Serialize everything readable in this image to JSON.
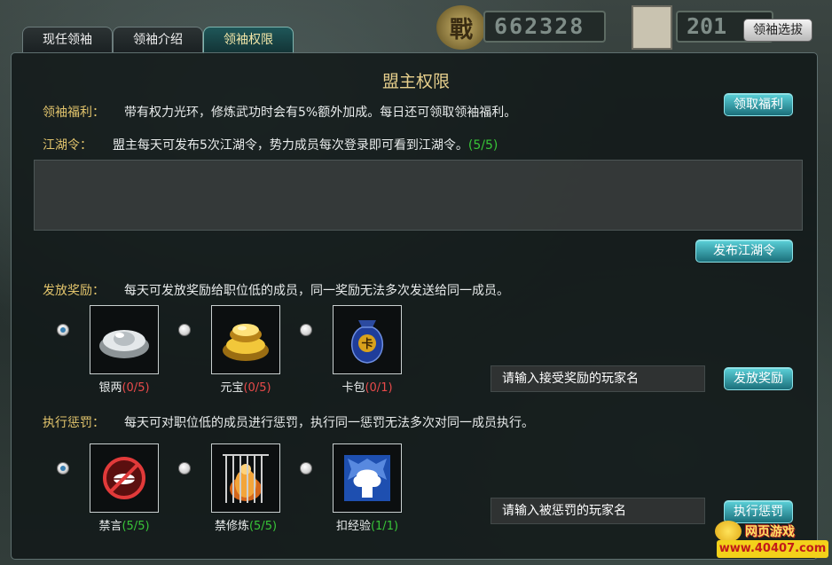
{
  "hud": {
    "war_glyph": "戰",
    "power_value": "662328",
    "rank_value": "201",
    "select_button": "领袖选拔"
  },
  "tabs": [
    {
      "label": "现任领袖",
      "active": false
    },
    {
      "label": "领袖介绍",
      "active": false
    },
    {
      "label": "领袖权限",
      "active": true
    }
  ],
  "panel": {
    "title": "盟主权限",
    "welfare": {
      "label": "领袖福利：",
      "text": "带有权力光环，修炼武功时会有5%额外加成。每日还可领取领袖福利。",
      "button": "领取福利"
    },
    "decree": {
      "label": "江湖令：",
      "text": "盟主每天可发布5次江湖令，势力成员每次登录即可看到江湖令。",
      "count": "(5/5)",
      "button": "发布江湖令"
    },
    "reward": {
      "label": "发放奖励：",
      "text": "每天可发放奖励给职位低的成员，同一奖励无法多次发送给同一成员。",
      "items": [
        {
          "name": "银两",
          "count": "(0/5)",
          "selected": true,
          "icon": "silver-ingot-icon"
        },
        {
          "name": "元宝",
          "count": "(0/5)",
          "selected": false,
          "icon": "gold-ingot-icon"
        },
        {
          "name": "卡包",
          "count": "(0/1)",
          "selected": false,
          "icon": "card-pack-icon"
        }
      ],
      "input_placeholder": "请输入接受奖励的玩家名",
      "button": "发放奖励"
    },
    "punish": {
      "label": "执行惩罚：",
      "text": "每天可对职位低的成员进行惩罚，执行同一惩罚无法多次对同一成员执行。",
      "items": [
        {
          "name": "禁言",
          "count": "(5/5)",
          "selected": true,
          "icon": "mute-icon"
        },
        {
          "name": "禁修炼",
          "count": "(5/5)",
          "selected": false,
          "icon": "cultivation-ban-icon"
        },
        {
          "name": "扣经验",
          "count": "(1/1)",
          "selected": false,
          "icon": "deduct-exp-icon"
        }
      ],
      "input_placeholder": "请输入被惩罚的玩家名",
      "button": "执行惩罚"
    }
  },
  "watermark": {
    "top": "网页游戏",
    "bottom": "www.40407.com"
  },
  "colors": {
    "gold_label": "#e2c46c",
    "green_count": "#38c538",
    "red_count": "#e84a4a",
    "accent_button": "#2aa0ac"
  }
}
